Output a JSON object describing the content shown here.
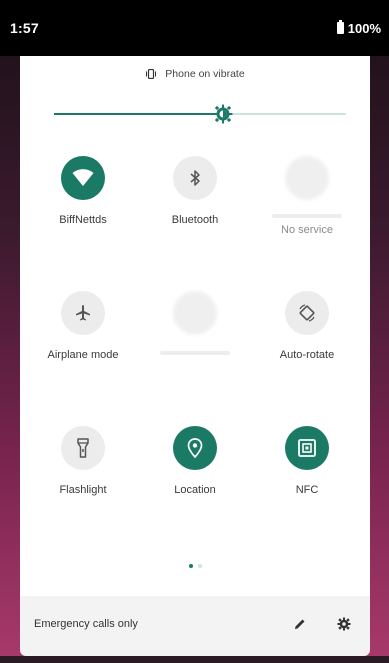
{
  "status_bar": {
    "time": "1:57",
    "battery": "100%"
  },
  "header": {
    "vibrate_label": "Phone on vibrate",
    "brightness_level": 0.58
  },
  "tiles": [
    {
      "label": "BiffNettds",
      "icon": "wifi-icon",
      "active": true
    },
    {
      "label": "Bluetooth",
      "icon": "bluetooth-icon",
      "active": false
    },
    {
      "label": "No service",
      "icon": "mobile-data-icon",
      "active": false
    },
    {
      "label": "Airplane mode",
      "icon": "airplane-icon",
      "active": false
    },
    {
      "label": "",
      "icon": "do-not-disturb-icon",
      "active": false
    },
    {
      "label": "Auto-rotate",
      "icon": "auto-rotate-icon",
      "active": false
    },
    {
      "label": "Flashlight",
      "icon": "flashlight-icon",
      "active": false
    },
    {
      "label": "Location",
      "icon": "location-icon",
      "active": true
    },
    {
      "label": "NFC",
      "icon": "nfc-icon",
      "active": true
    }
  ],
  "footer": {
    "text": "Emergency calls only"
  },
  "colors": {
    "accent": "#1a7a66",
    "inactive": "#ececec"
  }
}
